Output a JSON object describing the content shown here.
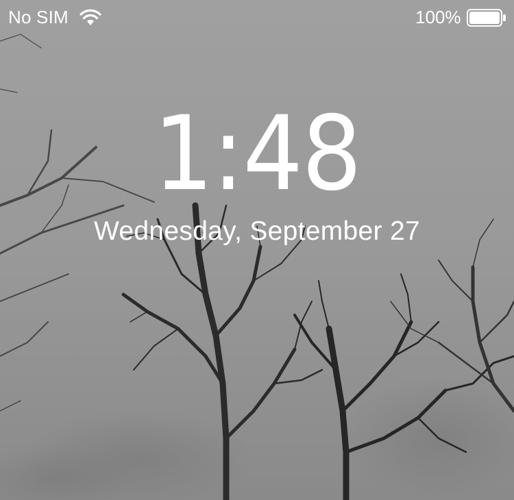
{
  "status_bar": {
    "carrier": "No SIM",
    "wifi_icon": "wifi-icon",
    "battery_percent": "100%",
    "battery_icon": "battery-full-icon"
  },
  "lock_screen": {
    "time": "1:48",
    "date": "Wednesday, September 27"
  },
  "colors": {
    "sky": "#9a9a9a",
    "trees": "#2e2e2e",
    "text": "#ffffff"
  }
}
